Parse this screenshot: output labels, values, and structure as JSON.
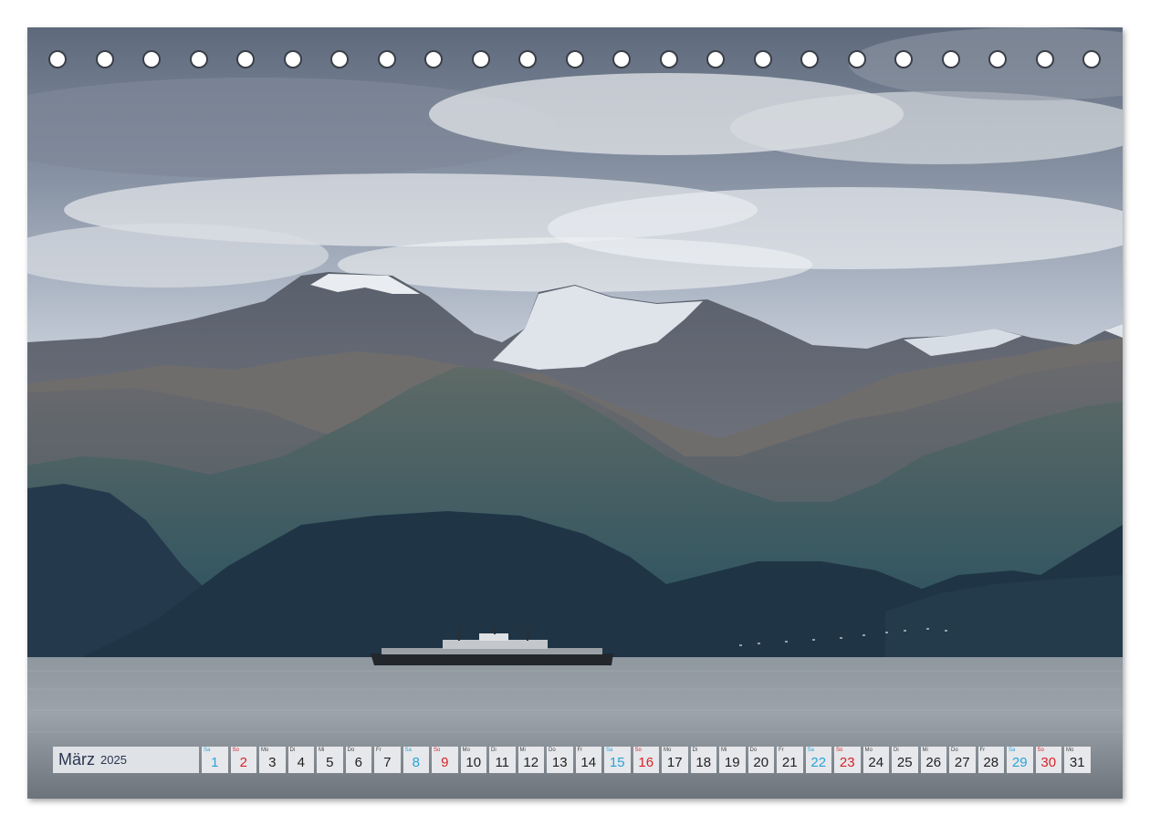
{
  "calendar": {
    "month": "März",
    "year": "2025",
    "days": [
      {
        "wd": "Sa",
        "num": "1",
        "type": "sat"
      },
      {
        "wd": "So",
        "num": "2",
        "type": "sun"
      },
      {
        "wd": "Mo",
        "num": "3",
        "type": "weekday"
      },
      {
        "wd": "Di",
        "num": "4",
        "type": "weekday"
      },
      {
        "wd": "Mi",
        "num": "5",
        "type": "weekday"
      },
      {
        "wd": "Do",
        "num": "6",
        "type": "weekday"
      },
      {
        "wd": "Fr",
        "num": "7",
        "type": "weekday"
      },
      {
        "wd": "Sa",
        "num": "8",
        "type": "sat"
      },
      {
        "wd": "So",
        "num": "9",
        "type": "sun"
      },
      {
        "wd": "Mo",
        "num": "10",
        "type": "weekday"
      },
      {
        "wd": "Di",
        "num": "11",
        "type": "weekday"
      },
      {
        "wd": "Mi",
        "num": "12",
        "type": "weekday"
      },
      {
        "wd": "Do",
        "num": "13",
        "type": "weekday"
      },
      {
        "wd": "Fr",
        "num": "14",
        "type": "weekday"
      },
      {
        "wd": "Sa",
        "num": "15",
        "type": "sat"
      },
      {
        "wd": "So",
        "num": "16",
        "type": "sun"
      },
      {
        "wd": "Mo",
        "num": "17",
        "type": "weekday"
      },
      {
        "wd": "Di",
        "num": "18",
        "type": "weekday"
      },
      {
        "wd": "Mi",
        "num": "19",
        "type": "weekday"
      },
      {
        "wd": "Do",
        "num": "20",
        "type": "weekday"
      },
      {
        "wd": "Fr",
        "num": "21",
        "type": "weekday"
      },
      {
        "wd": "Sa",
        "num": "22",
        "type": "sat"
      },
      {
        "wd": "So",
        "num": "23",
        "type": "sun"
      },
      {
        "wd": "Mo",
        "num": "24",
        "type": "weekday"
      },
      {
        "wd": "Di",
        "num": "25",
        "type": "weekday"
      },
      {
        "wd": "Mi",
        "num": "26",
        "type": "weekday"
      },
      {
        "wd": "Do",
        "num": "27",
        "type": "weekday"
      },
      {
        "wd": "Fr",
        "num": "28",
        "type": "weekday"
      },
      {
        "wd": "Sa",
        "num": "29",
        "type": "sat"
      },
      {
        "wd": "So",
        "num": "30",
        "type": "sun"
      },
      {
        "wd": "Mo",
        "num": "31",
        "type": "weekday"
      }
    ]
  },
  "binding": {
    "hole_count": 23
  },
  "colors": {
    "saturday": "#2aa3d8",
    "sunday": "#d8232a",
    "month_text": "#2a3550",
    "day_cell": "#e6e8eb"
  }
}
